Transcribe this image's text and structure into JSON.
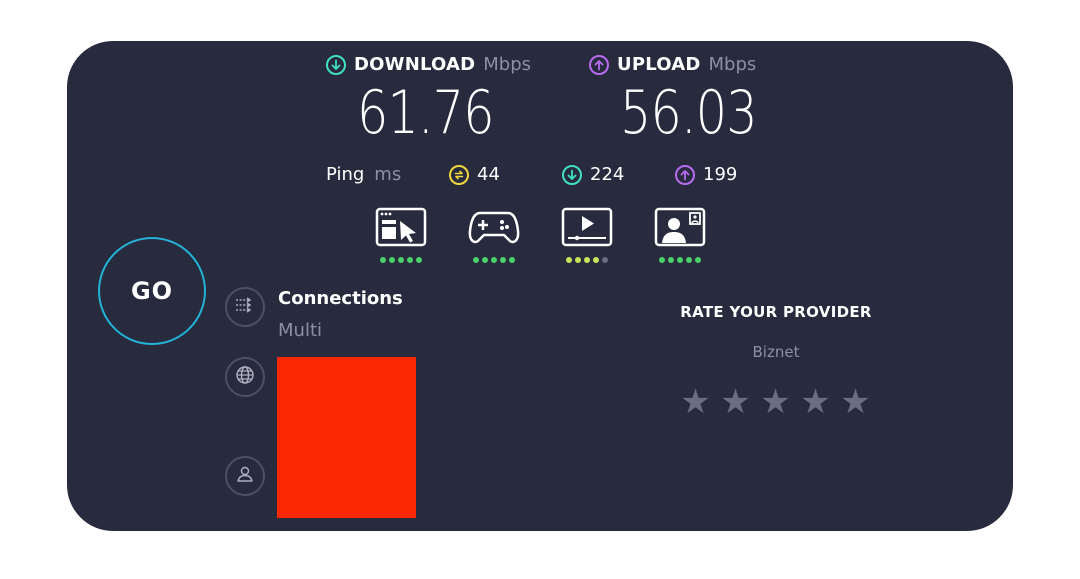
{
  "download": {
    "label": "DOWNLOAD",
    "unit": "Mbps",
    "value": "61.76",
    "icon": "download-arrow-icon",
    "color": "#3ee1c4"
  },
  "upload": {
    "label": "UPLOAD",
    "unit": "Mbps",
    "value": "56.03",
    "icon": "upload-arrow-icon",
    "color": "#b66cf0"
  },
  "ping": {
    "label": "Ping",
    "unit": "ms",
    "idle": {
      "value": "44",
      "icon": "idle-latency-icon",
      "color": "#f0d73e"
    },
    "download": {
      "value": "224",
      "icon": "download-latency-icon",
      "color": "#3ee1c4"
    },
    "upload": {
      "value": "199",
      "icon": "upload-latency-icon",
      "color": "#b66cf0"
    }
  },
  "quality": [
    {
      "icon": "web-browsing-icon",
      "score": 5
    },
    {
      "icon": "gaming-icon",
      "score": 5
    },
    {
      "icon": "video-streaming-icon",
      "score": 4
    },
    {
      "icon": "video-call-icon",
      "score": 5
    }
  ],
  "go_button": {
    "label": "GO"
  },
  "connections": {
    "title": "Connections",
    "value": "Multi"
  },
  "rating": {
    "title": "RATE YOUR PROVIDER",
    "provider": "Biznet",
    "stars_total": 5,
    "stars_filled": 0
  },
  "colors": {
    "card_bg": "#282a3d",
    "go_ring": "#22b3d6",
    "quality_good": "#4ad16a",
    "redaction": "#fb2804"
  }
}
